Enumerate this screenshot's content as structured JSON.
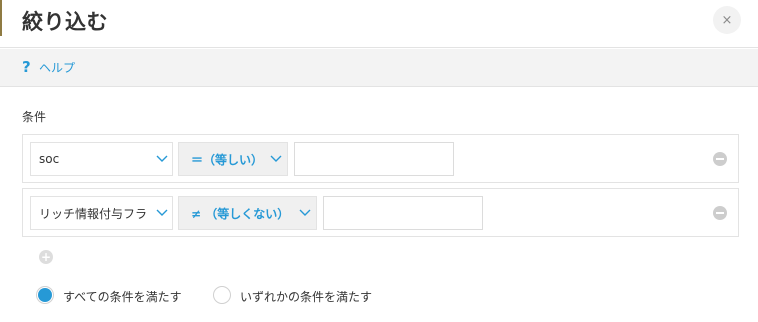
{
  "dialog": {
    "title": "絞り込む",
    "close_icon": "close-icon",
    "close_glyph": "×"
  },
  "help": {
    "icon": "question-icon",
    "icon_glyph": "?",
    "label": "ヘルプ"
  },
  "conditions": {
    "label": "条件",
    "rows": [
      {
        "field": "soc",
        "operator": "＝（等しい）",
        "value": ""
      },
      {
        "field": "リッチ情報付与フラ",
        "operator": "≠ （等しくない）",
        "value": ""
      }
    ],
    "add_icon": "plus-circle-icon",
    "add_glyph": "+",
    "remove_icon": "minus-circle-icon"
  },
  "match_mode": {
    "options": [
      {
        "label": "すべての条件を満たす",
        "selected": true
      },
      {
        "label": "いずれかの条件を満たす",
        "selected": false
      }
    ]
  },
  "colors": {
    "accent": "#2699d6",
    "border": "#e3e3e3",
    "help_bar_bg": "#f3f3f3",
    "operator_bg": "#f0f0f0",
    "text": "#333333"
  }
}
